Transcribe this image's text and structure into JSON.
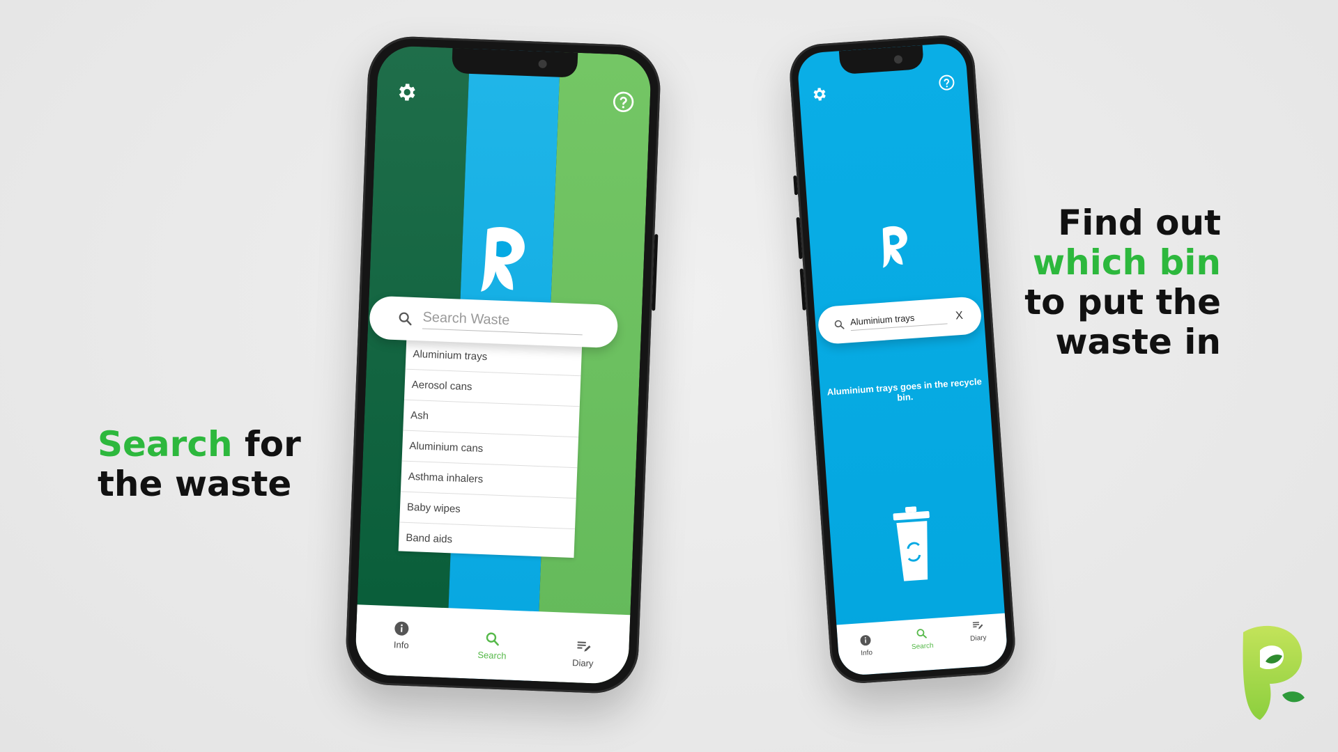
{
  "headlines": {
    "left": {
      "accent": "Search",
      "rest_line1": " for",
      "line2": "the waste"
    },
    "right": {
      "line1": "Find out",
      "accent": "which bin",
      "line3": "to put the",
      "line4": "waste in"
    }
  },
  "colors": {
    "dark_green": "#0b5e3c",
    "blue": "#05a9e3",
    "light_green": "#6cc062",
    "accent_green": "#2db83d",
    "tab_active": "#56b94a",
    "brand_lime": "#a8d84a"
  },
  "phone_left": {
    "top_icons": {
      "left": "gear-icon",
      "right": "help-circle-icon"
    },
    "search": {
      "placeholder": "Search Waste"
    },
    "suggestions": [
      "Aluminium trays",
      "Aerosol cans",
      "Ash",
      "Aluminium cans",
      "Asthma inhalers",
      "Baby wipes",
      "Band aids"
    ],
    "tabs": [
      {
        "label": "Info",
        "icon": "info-icon"
      },
      {
        "label": "Search",
        "icon": "search-icon",
        "active": true
      },
      {
        "label": "Diary",
        "icon": "diary-icon"
      }
    ]
  },
  "phone_right": {
    "search": {
      "value": "Aluminium trays",
      "clear_label": "X"
    },
    "result": "Aluminium trays goes in the recycle bin.",
    "bin_icon": "recycle-bin-icon",
    "tabs": [
      {
        "label": "Info",
        "icon": "info-icon"
      },
      {
        "label": "Search",
        "icon": "search-icon",
        "active": true
      },
      {
        "label": "Diary",
        "icon": "diary-icon"
      }
    ]
  },
  "brand_logo": "app-logo-r"
}
